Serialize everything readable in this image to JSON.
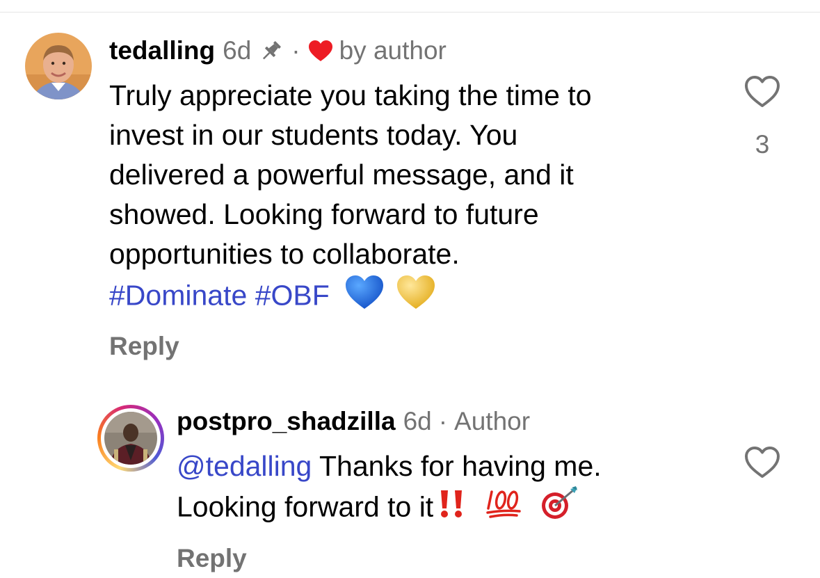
{
  "comments": [
    {
      "username": "tedalling",
      "time": "6d",
      "liked_by": "by author",
      "lines": [
        "Truly appreciate you taking the time to",
        "invest in our students today. You",
        "delivered a powerful message, and it",
        "showed. Looking forward to future",
        "opportunities to collaborate."
      ],
      "hashtags": [
        "#Dominate",
        "#OBF"
      ],
      "reply_label": "Reply",
      "like_count": "3",
      "pinned": true,
      "emojis": [
        "blue-heart",
        "yellow-heart"
      ]
    },
    {
      "username": "postpro_shadzilla",
      "time": "6d",
      "badge": "Author",
      "mention": "@tedalling",
      "line1_rest": "Thanks for having me.",
      "line2": "Looking forward to it",
      "emojis": [
        "double-exclamation",
        "hundred-points",
        "direct-hit"
      ],
      "reply_label": "Reply"
    }
  ],
  "colors": {
    "link": "#3847c8",
    "secondary_text": "#737373",
    "heart_red": "#ed1c24",
    "blue_heart": "#1f6fe0",
    "yellow_heart": "#f5c74b"
  }
}
